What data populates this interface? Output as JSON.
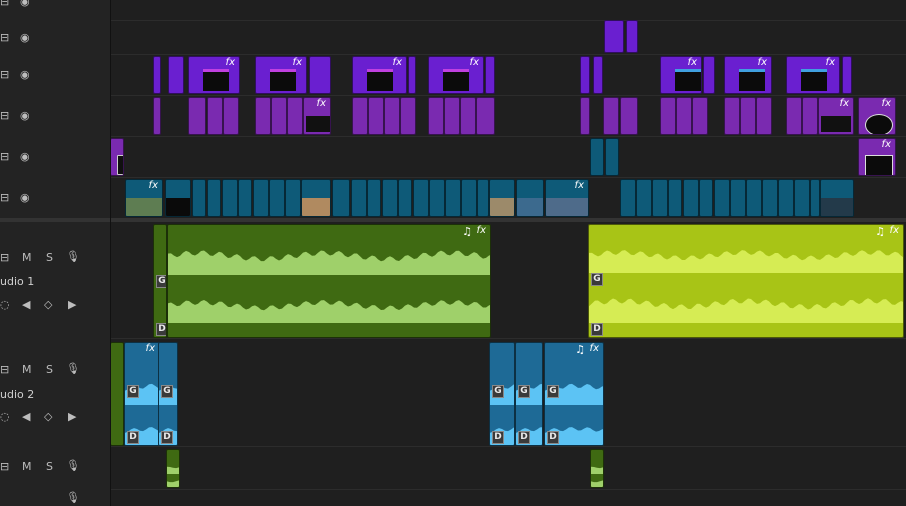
{
  "tracks": {
    "audio1": {
      "label": "udio 1",
      "mute": "M",
      "solo": "S"
    },
    "audio2": {
      "label": "udio 2",
      "mute": "M",
      "solo": "S"
    },
    "audio3": {
      "mute": "M",
      "solo": "S"
    }
  },
  "clip_markers": {
    "fx": "fx",
    "gain": "G",
    "duck": "D",
    "note": "♫"
  },
  "icons": [
    "toggle-output-icon",
    "eye-icon",
    "mic-icon",
    "keyframe-prev-icon",
    "keyframe-add-icon",
    "keyframe-next-icon"
  ],
  "colors": {
    "video_purple": "#7a2ab0",
    "video_violet": "#6a1fd0",
    "video_teal": "#0e5a78",
    "audio_green": "#3f6a12",
    "audio_lime": "#a8c416",
    "audio_blue": "#1e6a96"
  }
}
